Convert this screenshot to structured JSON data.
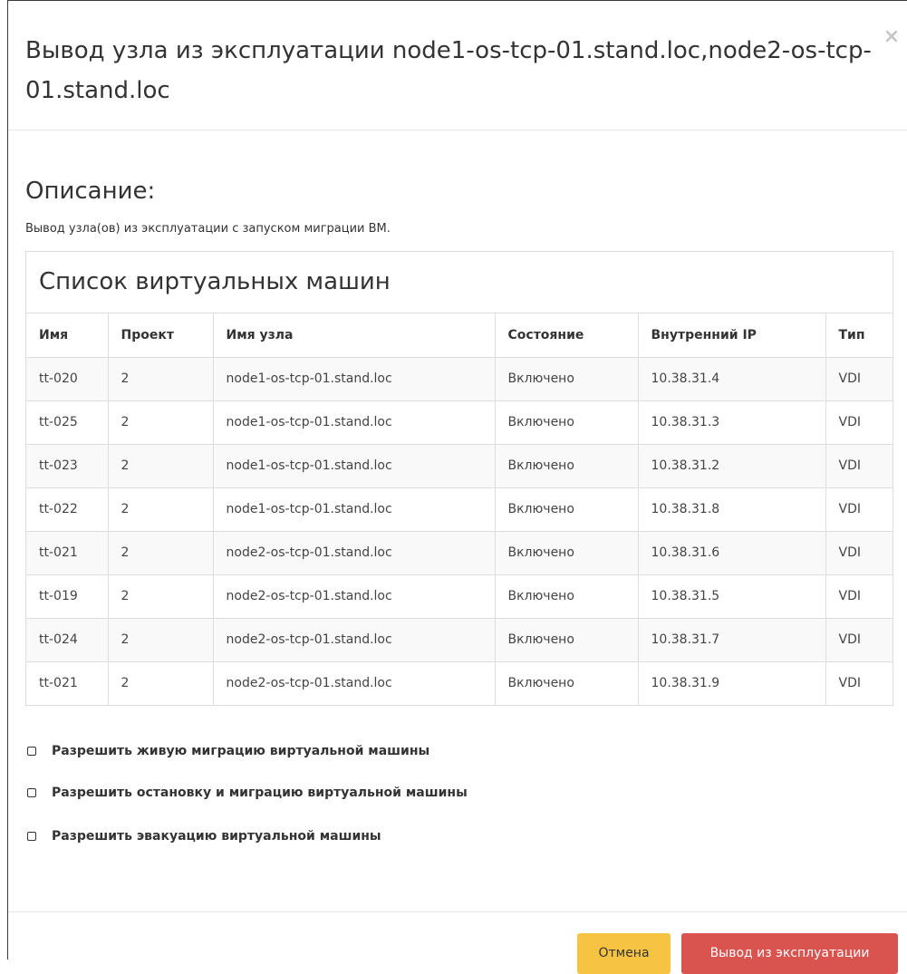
{
  "modal": {
    "title": "Вывод узла из эксплуатации node1-os-tcp-01.stand.loc,node2-os-tcp-01.stand.loc",
    "close_icon": "×"
  },
  "description": {
    "heading": "Описание:",
    "text": "Вывод узла(ов) из эксплуатации с запуском миграции ВМ."
  },
  "vm_list": {
    "title": "Список виртуальных машин",
    "columns": [
      "Имя",
      "Проект",
      "Имя узла",
      "Состояние",
      "Внутренний IP",
      "Тип"
    ],
    "rows": [
      [
        "tt-020",
        "2",
        "node1-os-tcp-01.stand.loc",
        "Включено",
        "10.38.31.4",
        "VDI"
      ],
      [
        "tt-025",
        "2",
        "node1-os-tcp-01.stand.loc",
        "Включено",
        "10.38.31.3",
        "VDI"
      ],
      [
        "tt-023",
        "2",
        "node1-os-tcp-01.stand.loc",
        "Включено",
        "10.38.31.2",
        "VDI"
      ],
      [
        "tt-022",
        "2",
        "node1-os-tcp-01.stand.loc",
        "Включено",
        "10.38.31.8",
        "VDI"
      ],
      [
        "tt-021",
        "2",
        "node2-os-tcp-01.stand.loc",
        "Включено",
        "10.38.31.6",
        "VDI"
      ],
      [
        "tt-019",
        "2",
        "node2-os-tcp-01.stand.loc",
        "Включено",
        "10.38.31.5",
        "VDI"
      ],
      [
        "tt-024",
        "2",
        "node2-os-tcp-01.stand.loc",
        "Включено",
        "10.38.31.7",
        "VDI"
      ],
      [
        "tt-021",
        "2",
        "node2-os-tcp-01.stand.loc",
        "Включено",
        "10.38.31.9",
        "VDI"
      ]
    ]
  },
  "options": {
    "live_migration": "Разрешить живую миграцию виртуальной машины",
    "stop_migration": "Разрешить остановку и миграцию виртуальной машины",
    "evacuation": "Разрешить эвакуацию виртуальной машины"
  },
  "footer": {
    "cancel_label": "Отмена",
    "decommission_label": "Вывод из эксплуатации"
  },
  "colors": {
    "cancel_bg": "#f6c342",
    "decommission_bg": "#d9534f"
  }
}
